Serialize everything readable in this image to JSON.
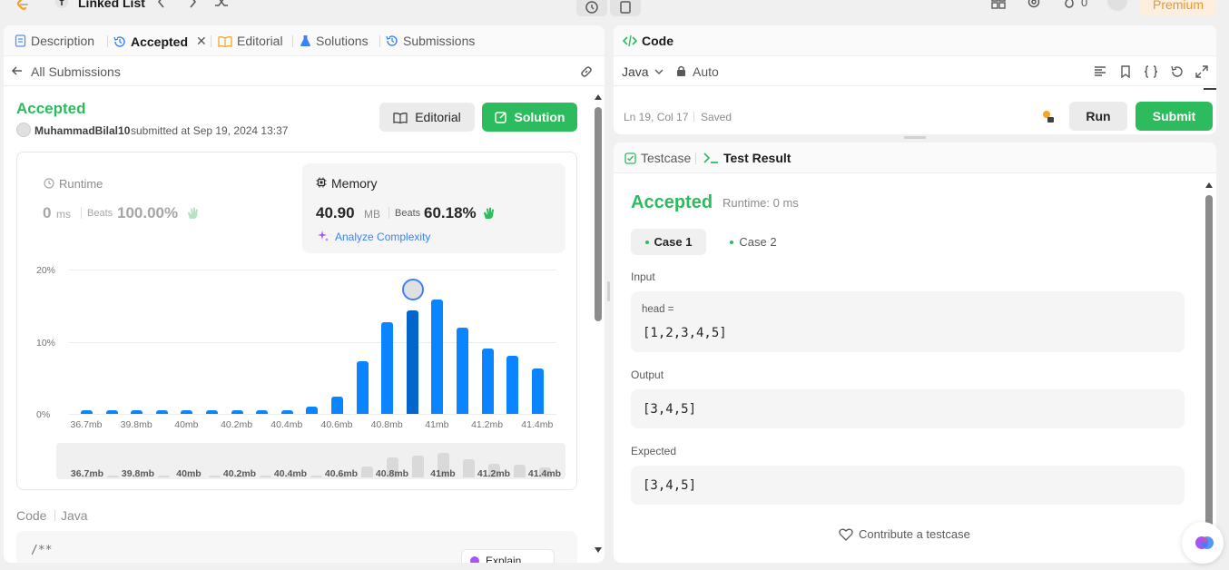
{
  "topbar": {
    "problem_list_label": "Linked List",
    "premium_label": "Premium",
    "streak_count": "0"
  },
  "left_tabs": [
    {
      "label": "Description",
      "icon": "description-icon"
    },
    {
      "label": "Accepted",
      "icon": "history-icon"
    },
    {
      "label": "Editorial",
      "icon": "book-icon"
    },
    {
      "label": "Solutions",
      "icon": "flask-icon"
    },
    {
      "label": "Submissions",
      "icon": "history-icon"
    }
  ],
  "submission": {
    "back_label": "All Submissions",
    "status": "Accepted",
    "username": "MuhammadBilal10",
    "submitted_text": "submitted at Sep 19, 2024 13:37",
    "editorial_button": "Editorial",
    "solution_button": "Solution"
  },
  "runtime": {
    "label": "Runtime",
    "value": "0",
    "unit": "ms",
    "beats_label": "Beats",
    "beats_value": "100.00%"
  },
  "memory": {
    "label": "Memory",
    "value": "40.90",
    "unit": "MB",
    "beats_label": "Beats",
    "beats_value": "60.18%",
    "analyze_label": "Analyze Complexity"
  },
  "chart_data": {
    "type": "bar",
    "categories": [
      "36.7mb",
      "",
      "39.8mb",
      "",
      "40mb",
      "",
      "40.2mb",
      "",
      "40.4mb",
      "",
      "40.6mb",
      "",
      "40.8mb",
      "",
      "41mb",
      "",
      "41.2mb",
      "",
      "41.4mb"
    ],
    "values": [
      0.5,
      0.5,
      0.5,
      0.5,
      0.5,
      0.5,
      0.5,
      0.5,
      0.5,
      1.0,
      2.4,
      7.3,
      12.7,
      14.4,
      15.8,
      11.9,
      9.1,
      8.0,
      6.3
    ],
    "highlight_index": 13,
    "yticks": [
      "20%",
      "10%",
      "0%"
    ],
    "ylim": [
      0,
      20
    ],
    "title": "",
    "xlabel": "",
    "ylabel": ""
  },
  "minimap_labels": [
    "36.7mb",
    "39.8mb",
    "40mb",
    "40.2mb",
    "40.4mb",
    "40.6mb",
    "40.8mb",
    "41mb",
    "41.2mb",
    "41.4mb"
  ],
  "code_section": {
    "label": "Code",
    "language": "Java",
    "first_line": "/**",
    "explain_label": "Explain"
  },
  "code_panel": {
    "title": "Code",
    "language": "Java",
    "mode": "Auto",
    "cursor": "Ln 19, Col 17",
    "saved": "Saved",
    "run_label": "Run",
    "submit_label": "Submit"
  },
  "result": {
    "testcase_tab": "Testcase",
    "result_tab": "Test Result",
    "status": "Accepted",
    "runtime_text": "Runtime: 0 ms",
    "cases": [
      "Case 1",
      "Case 2"
    ],
    "input_label": "Input",
    "input_var": "head =",
    "input_value": "[1,2,3,4,5]",
    "output_label": "Output",
    "output_value": "[3,4,5]",
    "expected_label": "Expected",
    "expected_value": "[3,4,5]",
    "contribute_label": "Contribute a testcase"
  },
  "colors": {
    "accent_green": "#2cbb5d",
    "bar_blue": "#0a84ff",
    "bar_highlight": "#0066cc",
    "premium_orange": "#e39a2f"
  }
}
